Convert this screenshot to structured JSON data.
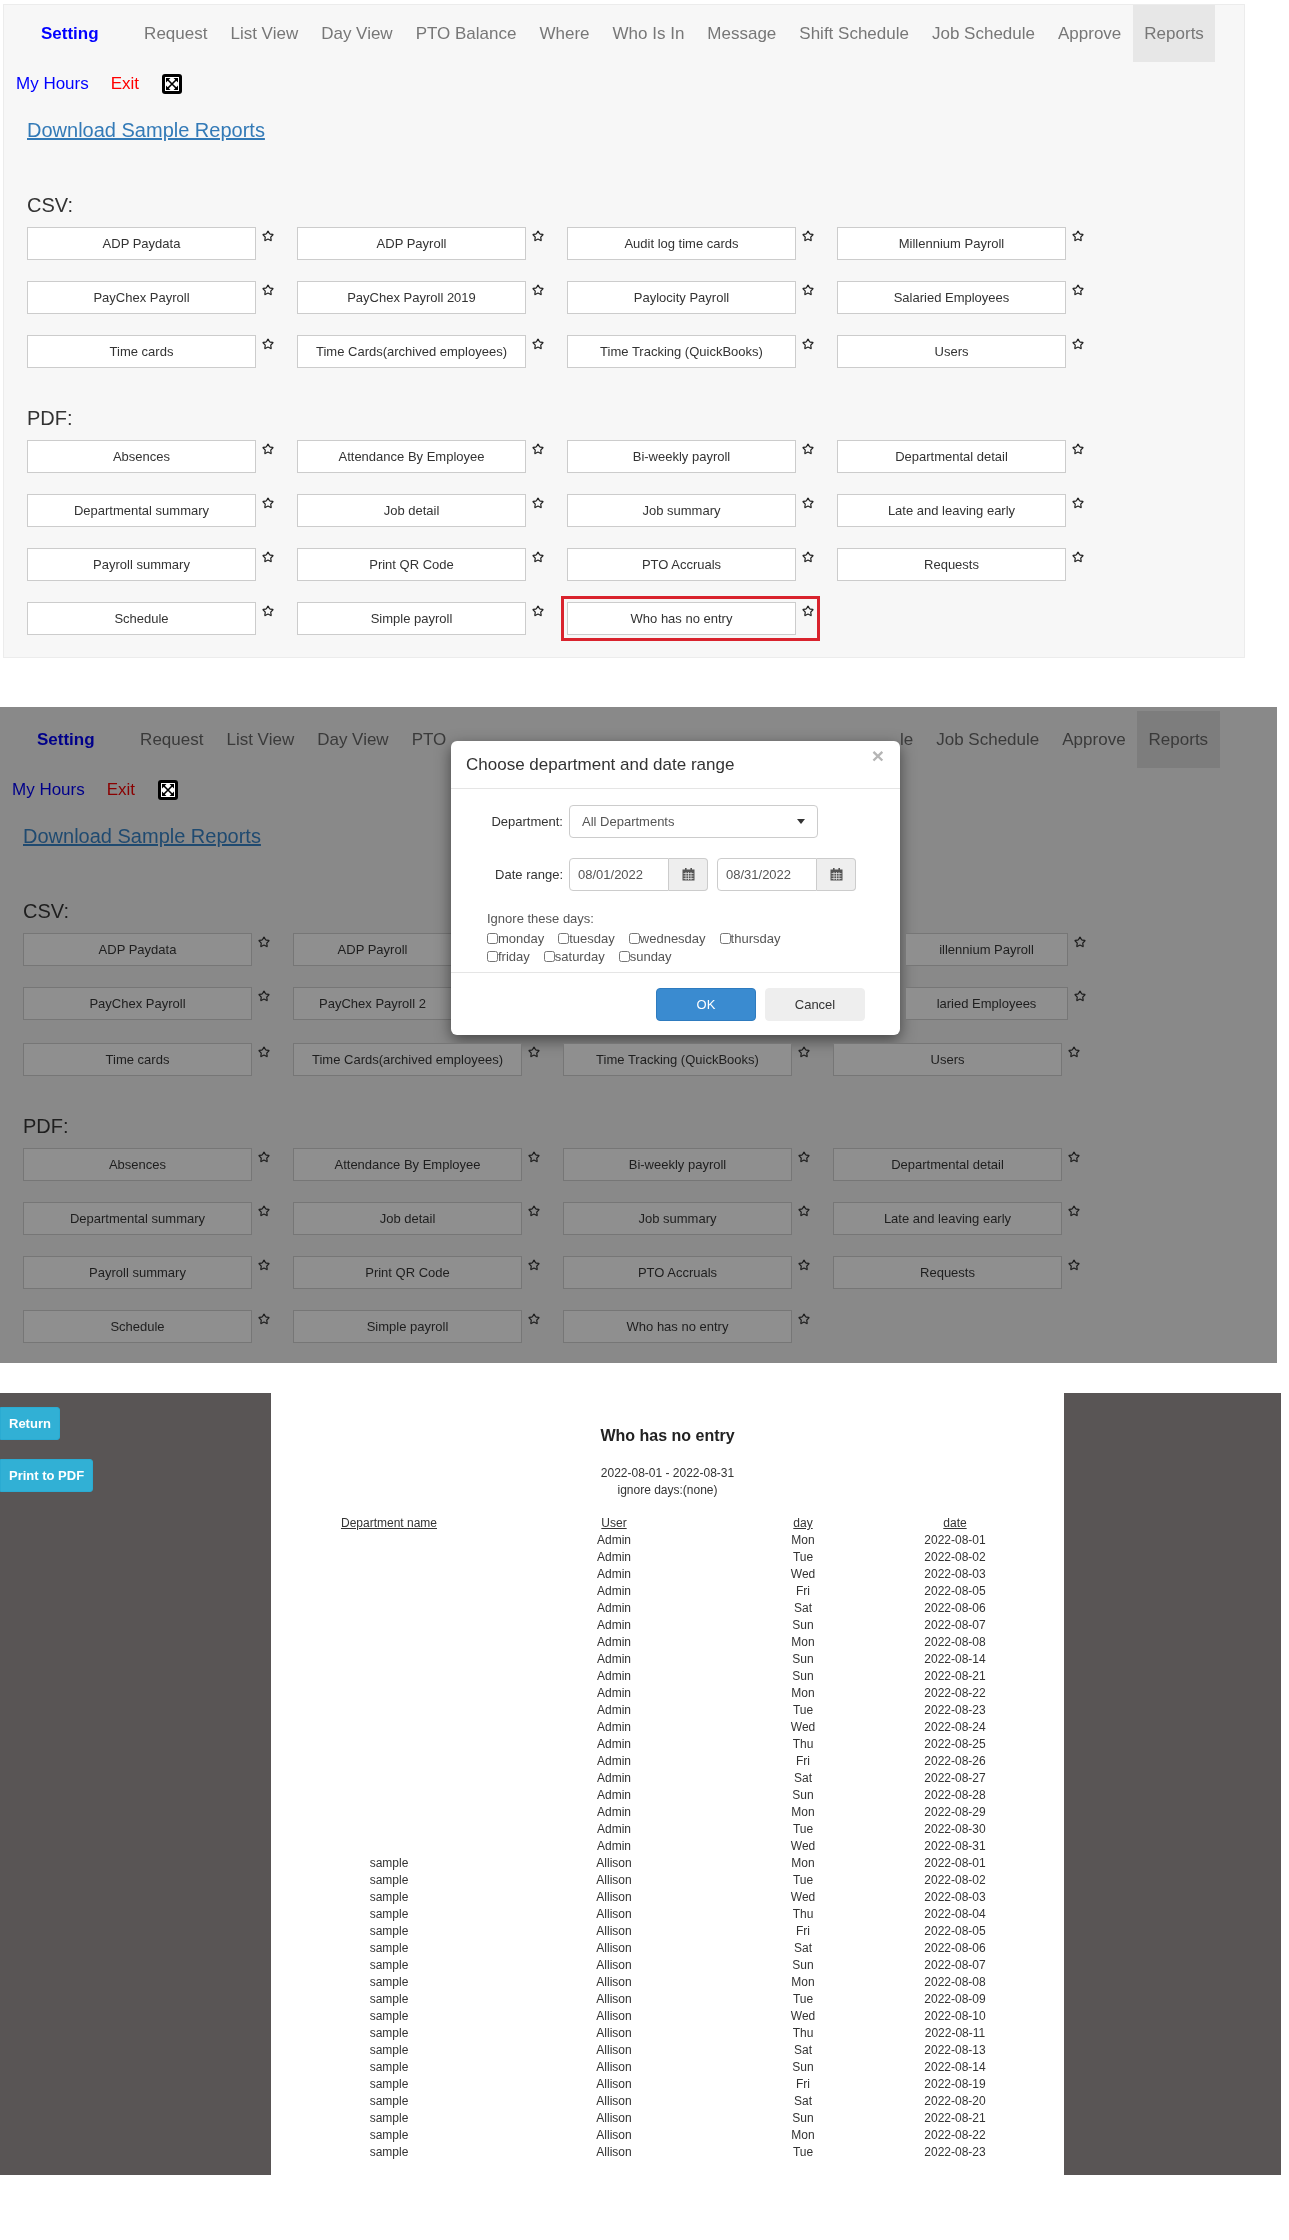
{
  "report_list": {
    "nav": {
      "brand": "Setting",
      "items": [
        {
          "label": "Request",
          "selected": false
        },
        {
          "label": "List View",
          "selected": false
        },
        {
          "label": "Day View",
          "selected": false
        },
        {
          "label": "PTO Balance",
          "selected": false
        },
        {
          "label": "Where",
          "selected": false
        },
        {
          "label": "Who Is In",
          "selected": false
        },
        {
          "label": "Message",
          "selected": false
        },
        {
          "label": "Shift Schedule",
          "selected": false
        },
        {
          "label": "Job Schedule",
          "selected": false
        },
        {
          "label": "Approve",
          "selected": false
        },
        {
          "label": "Reports",
          "selected": true
        }
      ]
    },
    "secondary_links": [
      {
        "label": "My Hours",
        "kind": "link"
      },
      {
        "label": "Exit",
        "kind": "exit"
      }
    ],
    "download_link": "Download Sample Reports",
    "sections": [
      {
        "heading": "CSV:",
        "reports": [
          {
            "label": "ADP Paydata",
            "highlighted": false
          },
          {
            "label": "ADP Payroll",
            "highlighted": false
          },
          {
            "label": "Audit log time cards",
            "highlighted": false
          },
          {
            "label": "Millennium Payroll",
            "highlighted": false
          },
          {
            "label": "PayChex Payroll",
            "highlighted": false
          },
          {
            "label": "PayChex Payroll 2019",
            "highlighted": false
          },
          {
            "label": "Paylocity Payroll",
            "highlighted": false
          },
          {
            "label": "Salaried Employees",
            "highlighted": false
          },
          {
            "label": "Time cards",
            "highlighted": false
          },
          {
            "label": "Time Cards(archived employees)",
            "highlighted": false
          },
          {
            "label": "Time Tracking (QuickBooks)",
            "highlighted": false
          },
          {
            "label": "Users",
            "highlighted": false
          }
        ]
      },
      {
        "heading": "PDF:",
        "reports": [
          {
            "label": "Absences",
            "highlighted": false
          },
          {
            "label": "Attendance By Employee",
            "highlighted": false
          },
          {
            "label": "Bi-weekly payroll",
            "highlighted": false
          },
          {
            "label": "Departmental detail",
            "highlighted": false
          },
          {
            "label": "Departmental summary",
            "highlighted": false
          },
          {
            "label": "Job detail",
            "highlighted": false
          },
          {
            "label": "Job summary",
            "highlighted": false
          },
          {
            "label": "Late and leaving early",
            "highlighted": false
          },
          {
            "label": "Payroll summary",
            "highlighted": false
          },
          {
            "label": "Print QR Code",
            "highlighted": false
          },
          {
            "label": "PTO Accruals",
            "highlighted": false
          },
          {
            "label": "Requests",
            "highlighted": false
          },
          {
            "label": "Schedule",
            "highlighted": false
          },
          {
            "label": "Simple payroll",
            "highlighted": false
          },
          {
            "label": "Who has no entry",
            "highlighted": true
          }
        ]
      }
    ]
  },
  "dialog_screen": {
    "nav_left": {
      "brand": "Setting",
      "items": [
        {
          "label": "Request",
          "selected": false,
          "kind": "full"
        },
        {
          "label": "List View",
          "selected": false,
          "kind": "full"
        },
        {
          "label": "Day View",
          "selected": false,
          "kind": "full"
        },
        {
          "label": "PTO",
          "selected": false,
          "kind": "cut_right"
        }
      ]
    },
    "nav_right": [
      {
        "label": "le",
        "selected": false,
        "kind": "cut_left"
      },
      {
        "label": "Job Schedule",
        "selected": false,
        "kind": "full"
      },
      {
        "label": "Approve",
        "selected": false,
        "kind": "full"
      },
      {
        "label": "Reports",
        "selected": true,
        "kind": "full"
      }
    ],
    "secondary_links": [
      {
        "label": "My Hours",
        "kind": "link"
      },
      {
        "label": "Exit",
        "kind": "exit"
      }
    ],
    "download_link": "Download Sample Reports",
    "csv_heading": "CSV:",
    "csv_rows_beside_dialog": [
      {
        "left": [
          {
            "label": "ADP Paydata",
            "kind": "full"
          },
          {
            "label": "ADP Payroll",
            "kind": "cut_right"
          }
        ],
        "right": [
          {
            "label": "illennium Payroll",
            "kind": "cut_left"
          }
        ]
      },
      {
        "left": [
          {
            "label": "PayChex Payroll",
            "kind": "full"
          },
          {
            "label": "PayChex Payroll 2",
            "kind": "cut_right"
          }
        ],
        "right": [
          {
            "label": "laried Employees",
            "kind": "cut_left"
          }
        ]
      }
    ],
    "csv_reports_below": [
      "Time cards",
      "Time Cards(archived employees)",
      "Time Tracking (QuickBooks)",
      "Users"
    ],
    "pdf_heading": "PDF:",
    "pdf_reports": [
      "Absences",
      "Attendance By Employee",
      "Bi-weekly payroll",
      "Departmental detail",
      "Departmental summary",
      "Job detail",
      "Job summary",
      "Late and leaving early",
      "Payroll summary",
      "Print QR Code",
      "PTO Accruals",
      "Requests",
      "Schedule",
      "Simple payroll",
      "Who has no entry"
    ],
    "dialog": {
      "title": "Choose department and date range",
      "close": "×",
      "department_label": "Department:",
      "department_value": "All Departments",
      "date_label": "Date range:",
      "date_from": "08/01/2022",
      "date_to": "08/31/2022",
      "ignore_label": "Ignore these days:",
      "days": [
        {
          "label": "monday",
          "checked": false
        },
        {
          "label": "tuesday",
          "checked": false
        },
        {
          "label": "wednesday",
          "checked": false
        },
        {
          "label": "thursday",
          "checked": false
        },
        {
          "label": "friday",
          "checked": false
        },
        {
          "label": "saturday",
          "checked": false
        },
        {
          "label": "sunday",
          "checked": false
        }
      ],
      "buttons": [
        {
          "label": "OK",
          "kind": "primary"
        },
        {
          "label": "Cancel",
          "kind": "default"
        }
      ]
    }
  },
  "report_view": {
    "buttons": [
      "Return",
      "Print to PDF"
    ],
    "title": "Who has no entry",
    "date_range": "2022-08-01 - 2022-08-31",
    "ignore_days": "ignore days:(none)",
    "columns": [
      "Department name",
      "User",
      "day",
      "date"
    ],
    "rows": [
      {
        "user": "Admin",
        "day": "Mon",
        "date": "2022-08-01"
      },
      {
        "user": "Admin",
        "day": "Tue",
        "date": "2022-08-02"
      },
      {
        "user": "Admin",
        "day": "Wed",
        "date": "2022-08-03"
      },
      {
        "user": "Admin",
        "day": "Fri",
        "date": "2022-08-05"
      },
      {
        "user": "Admin",
        "day": "Sat",
        "date": "2022-08-06"
      },
      {
        "user": "Admin",
        "day": "Sun",
        "date": "2022-08-07"
      },
      {
        "user": "Admin",
        "day": "Mon",
        "date": "2022-08-08"
      },
      {
        "user": "Admin",
        "day": "Sun",
        "date": "2022-08-14"
      },
      {
        "user": "Admin",
        "day": "Sun",
        "date": "2022-08-21"
      },
      {
        "user": "Admin",
        "day": "Mon",
        "date": "2022-08-22"
      },
      {
        "user": "Admin",
        "day": "Tue",
        "date": "2022-08-23"
      },
      {
        "user": "Admin",
        "day": "Wed",
        "date": "2022-08-24"
      },
      {
        "user": "Admin",
        "day": "Thu",
        "date": "2022-08-25"
      },
      {
        "user": "Admin",
        "day": "Fri",
        "date": "2022-08-26"
      },
      {
        "user": "Admin",
        "day": "Sat",
        "date": "2022-08-27"
      },
      {
        "user": "Admin",
        "day": "Sun",
        "date": "2022-08-28"
      },
      {
        "user": "Admin",
        "day": "Mon",
        "date": "2022-08-29"
      },
      {
        "user": "Admin",
        "day": "Tue",
        "date": "2022-08-30"
      },
      {
        "user": "Admin",
        "day": "Wed",
        "date": "2022-08-31"
      },
      {
        "department": "sample",
        "user": "Allison",
        "day": "Mon",
        "date": "2022-08-01"
      },
      {
        "department": "sample",
        "user": "Allison",
        "day": "Tue",
        "date": "2022-08-02"
      },
      {
        "department": "sample",
        "user": "Allison",
        "day": "Wed",
        "date": "2022-08-03"
      },
      {
        "department": "sample",
        "user": "Allison",
        "day": "Thu",
        "date": "2022-08-04"
      },
      {
        "department": "sample",
        "user": "Allison",
        "day": "Fri",
        "date": "2022-08-05"
      },
      {
        "department": "sample",
        "user": "Allison",
        "day": "Sat",
        "date": "2022-08-06"
      },
      {
        "department": "sample",
        "user": "Allison",
        "day": "Sun",
        "date": "2022-08-07"
      },
      {
        "department": "sample",
        "user": "Allison",
        "day": "Mon",
        "date": "2022-08-08"
      },
      {
        "department": "sample",
        "user": "Allison",
        "day": "Tue",
        "date": "2022-08-09"
      },
      {
        "department": "sample",
        "user": "Allison",
        "day": "Wed",
        "date": "2022-08-10"
      },
      {
        "department": "sample",
        "user": "Allison",
        "day": "Thu",
        "date": "2022-08-11"
      },
      {
        "department": "sample",
        "user": "Allison",
        "day": "Sat",
        "date": "2022-08-13"
      },
      {
        "department": "sample",
        "user": "Allison",
        "day": "Sun",
        "date": "2022-08-14"
      },
      {
        "department": "sample",
        "user": "Allison",
        "day": "Fri",
        "date": "2022-08-19"
      },
      {
        "department": "sample",
        "user": "Allison",
        "day": "Sat",
        "date": "2022-08-20"
      },
      {
        "department": "sample",
        "user": "Allison",
        "day": "Sun",
        "date": "2022-08-21"
      },
      {
        "department": "sample",
        "user": "Allison",
        "day": "Mon",
        "date": "2022-08-22"
      },
      {
        "department": "sample",
        "user": "Allison",
        "day": "Tue",
        "date": "2022-08-23"
      }
    ]
  }
}
